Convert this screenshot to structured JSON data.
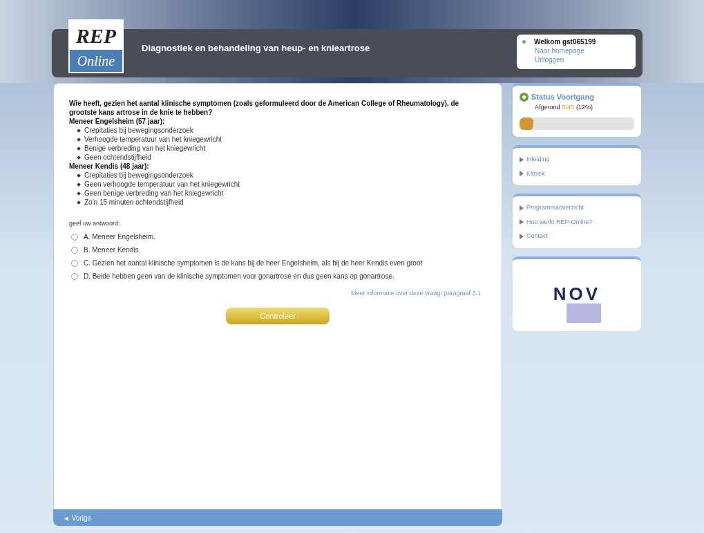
{
  "header": {
    "logo_top": "REP",
    "logo_bottom": "Online",
    "title": "Diagnostiek en behandeling van heup- en knieartrose"
  },
  "user_box": {
    "welcome": "Welkom gst065199",
    "links": [
      "Naar homepage",
      "Uitloggen"
    ]
  },
  "question": {
    "text": "Wie heeft, gezien het aantal klinische symptomen (zoals geformuleerd door de American College of Rheumatology), de grootste kans artrose in de knie te hebben?",
    "cases": [
      {
        "title": "Meneer Engelsheim (57 jaar):",
        "items": [
          "Crepitaties bij bewegingsonderzoek",
          "Verhoogde temperatuur van het kniegewricht",
          "Benige verbreding van het kniegewricht",
          "Geen ochtendstijfheid"
        ]
      },
      {
        "title": "Meneer Kendis (48 jaar):",
        "items": [
          "Crepitaties bij bewegingsonderzoek",
          "Geen verhoogde temperatuur van het kniegewricht",
          "Geen benige verbreding van het kniegewricht",
          "Zo'n 15 minuten ochtendstijfheid"
        ]
      }
    ],
    "prompt": "geef uw antwoord:",
    "options": [
      {
        "label": "A. Meneer Engelsheim.",
        "selected": false
      },
      {
        "label": "B. Meneer Kendis.",
        "selected": false
      },
      {
        "label": "C. Gezien het aantal klinische symptomen is de kans bij de heer Engelsheim, als bij de heer Kendis even groot",
        "selected": false
      },
      {
        "label": "D. Beide hebben geen van de klinische symptomen voor gonartrose en dus geen kans op gonartrose.",
        "selected": false
      }
    ],
    "more_info": "Meer informatie over deze vraag: paragraaf 3.1",
    "button": "Controleer"
  },
  "footer": {
    "back": "◄ Vorige"
  },
  "progress": {
    "title": "Status Voortgang",
    "label": "Afgerond",
    "count": "5/40",
    "percent": "(12%)",
    "level": 0.12
  },
  "nav_groups": [
    [
      "Inleiding",
      "Kliniek"
    ],
    [
      "Programmaoverzicht",
      "Hoe werkt REP-Online?",
      "Contact"
    ]
  ],
  "sponsor": {
    "name": "NOV"
  }
}
